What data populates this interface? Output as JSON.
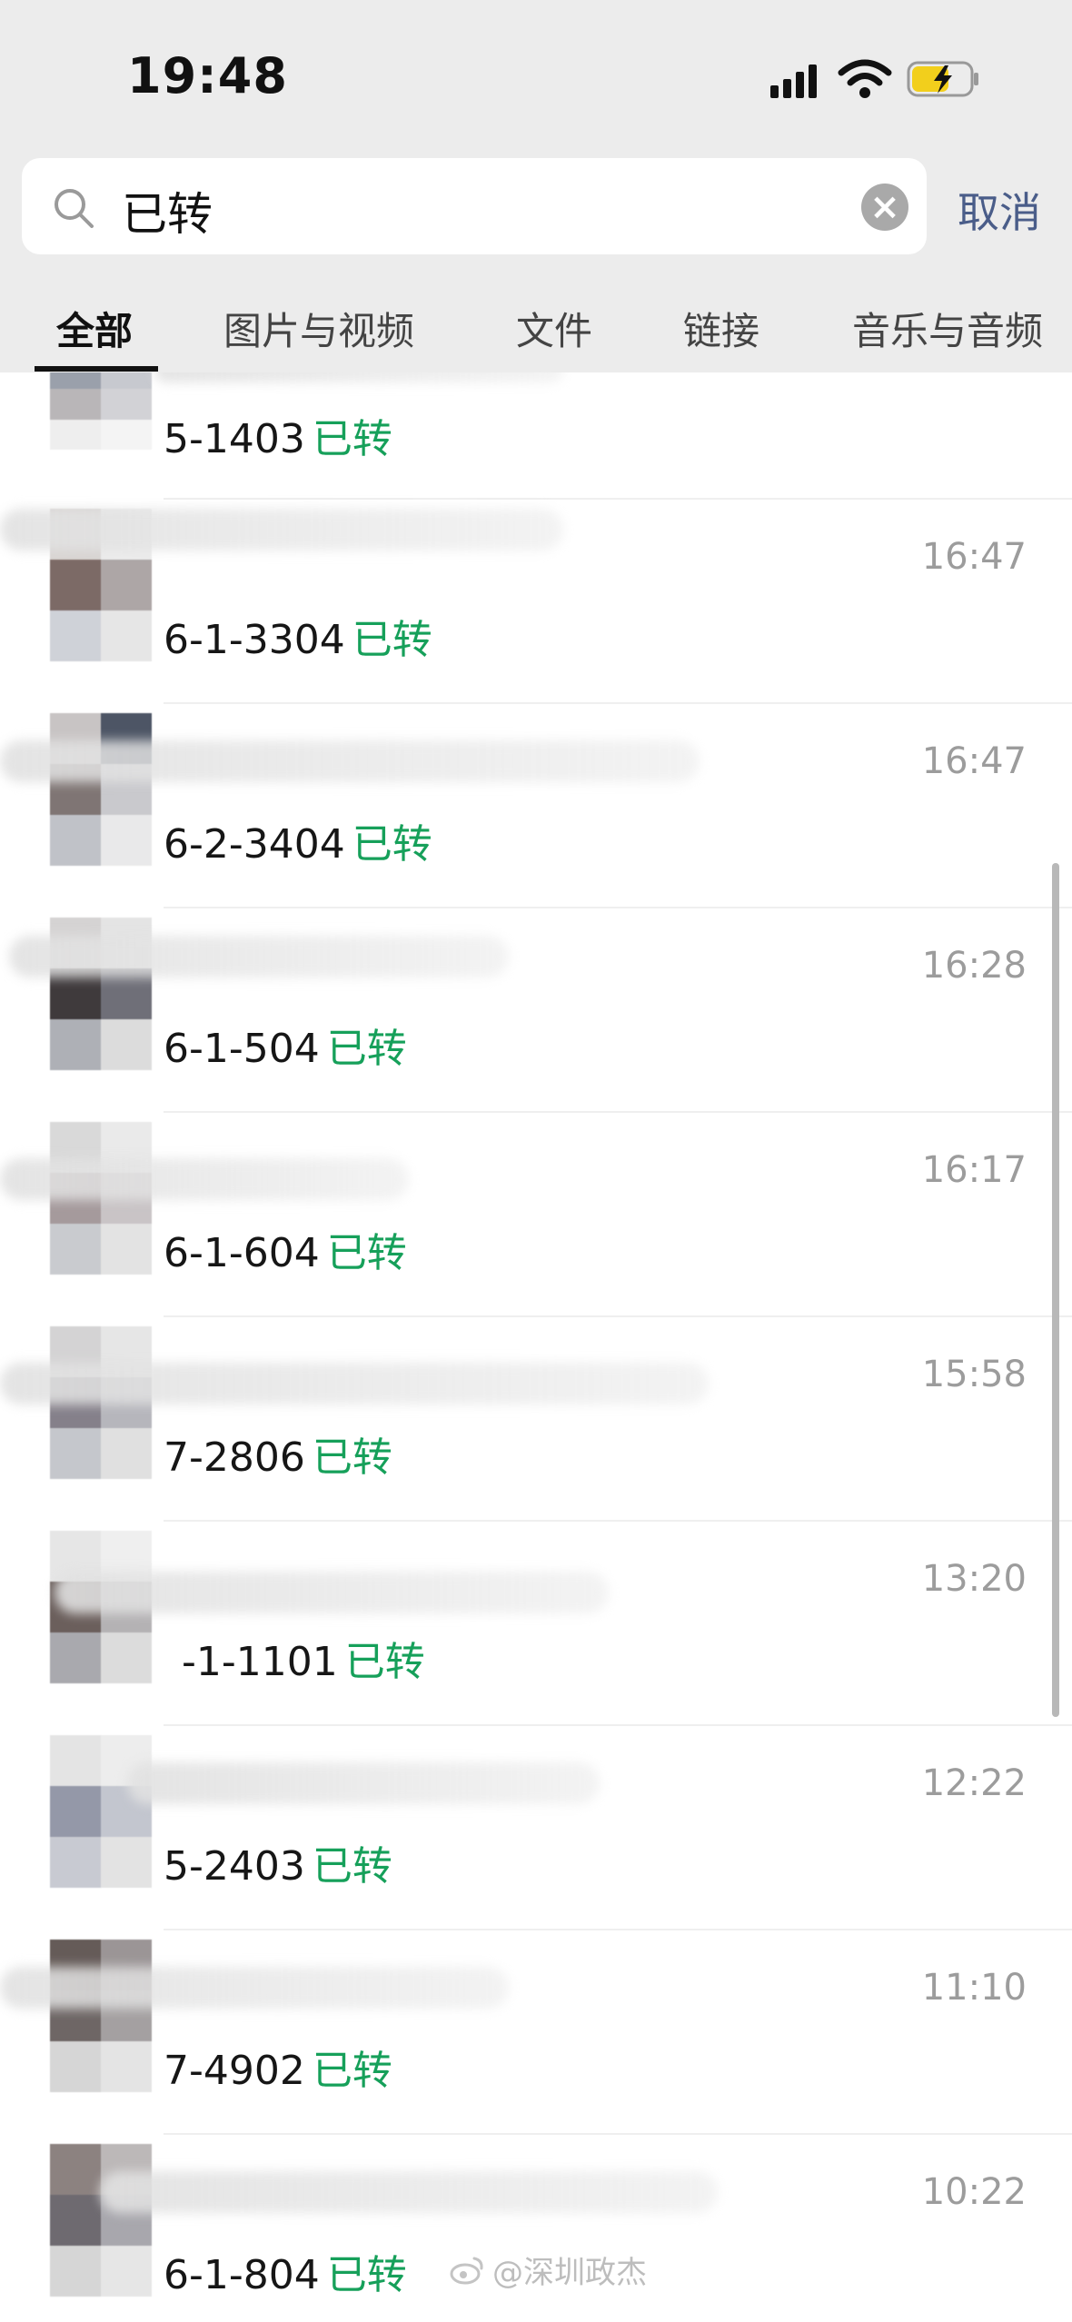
{
  "status_bar": {
    "time": "19:48"
  },
  "search": {
    "query": "已转",
    "cancel_label": "取消"
  },
  "tabs": [
    {
      "label": "全部",
      "active": true
    },
    {
      "label": "图片与视频",
      "active": false
    },
    {
      "label": "文件",
      "active": false
    },
    {
      "label": "链接",
      "active": false
    },
    {
      "label": "音乐与音频",
      "active": false
    }
  ],
  "results": [
    {
      "room": "5-1403",
      "status": "已转",
      "time": ""
    },
    {
      "room": "6-1-3304",
      "status": "已转",
      "time": "16:47"
    },
    {
      "room": "6-2-3404",
      "status": "已转",
      "time": "16:47"
    },
    {
      "room": "6-1-504",
      "status": "已转",
      "time": "16:28"
    },
    {
      "room": "6-1-604",
      "status": "已转",
      "time": "16:17"
    },
    {
      "room": "7-2806",
      "status": "已转",
      "time": "15:58"
    },
    {
      "room": "-1-1101",
      "status": "已转",
      "time": "13:20"
    },
    {
      "room": "5-2403",
      "status": "已转",
      "time": "12:22"
    },
    {
      "room": "7-4902",
      "status": "已转",
      "time": "11:10"
    },
    {
      "room": "6-1-804",
      "status": "已转",
      "time": "10:22"
    }
  ],
  "watermark": "@深圳政杰",
  "colors": {
    "status_green": "#16a05a",
    "cancel_blue": "#4a5d89",
    "background": "#ececec"
  }
}
